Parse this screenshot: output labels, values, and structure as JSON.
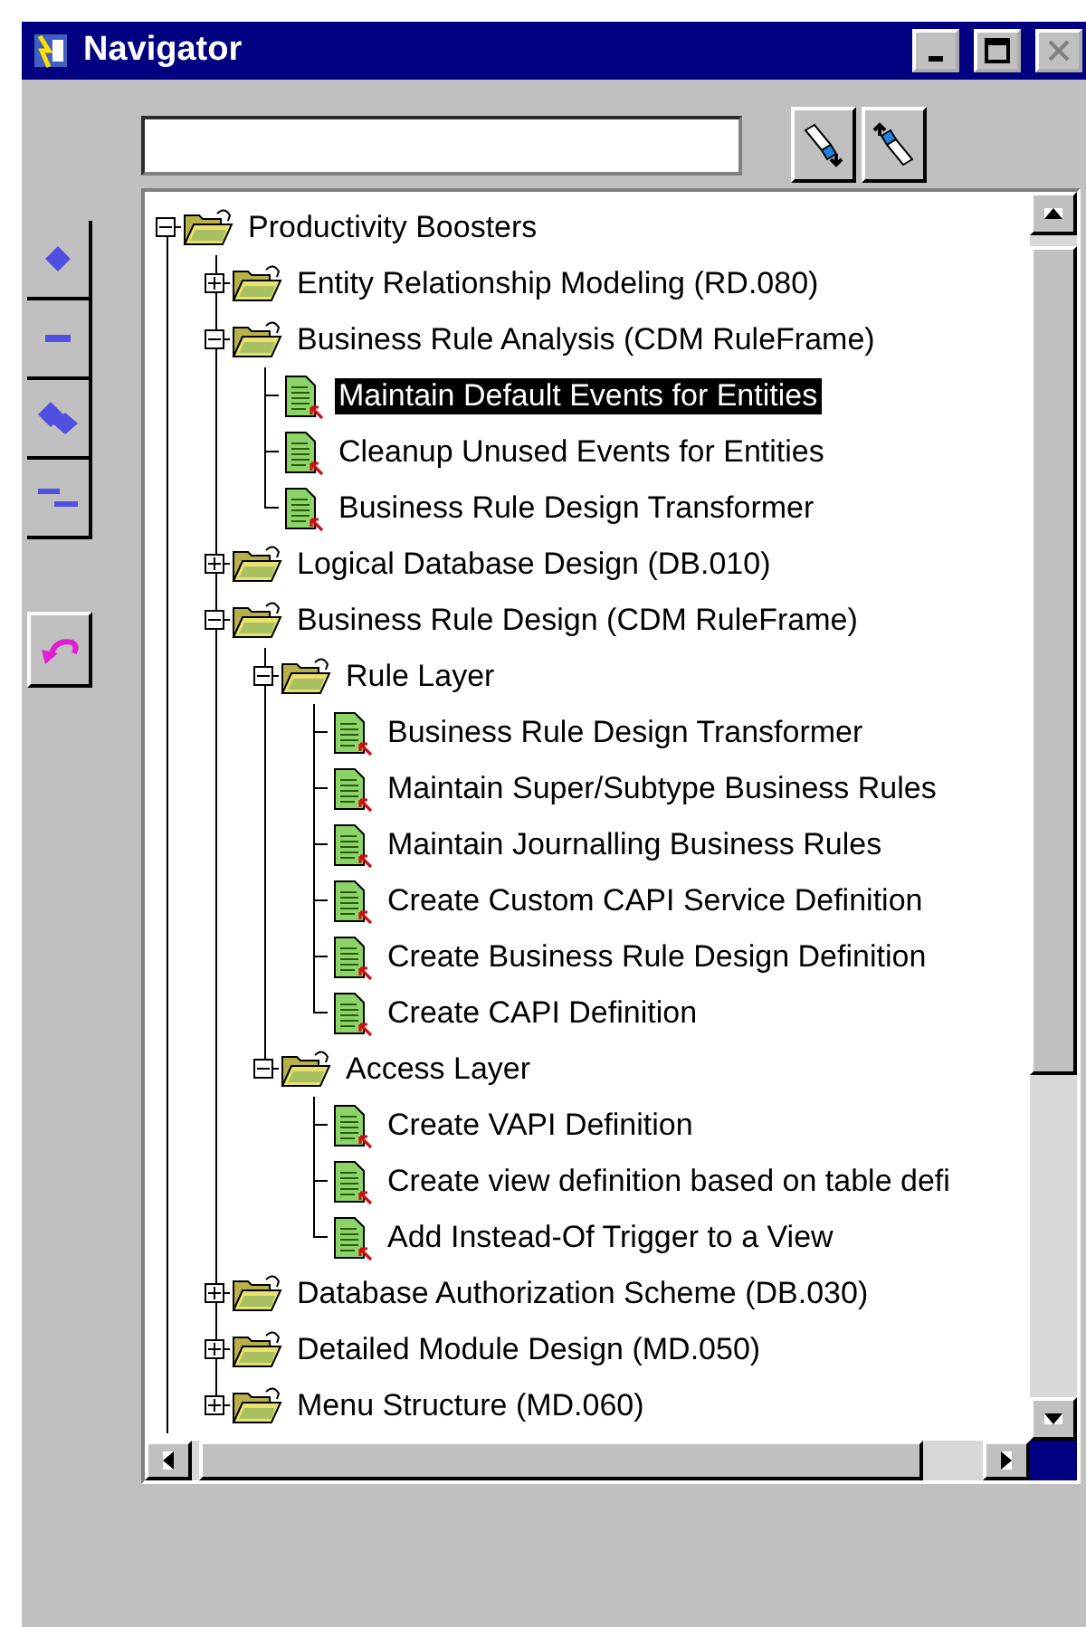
{
  "window": {
    "title": "Navigator"
  },
  "tree": [
    {
      "label": "Productivity Boosters",
      "kind": "folder",
      "expanded": true,
      "selected": false,
      "children": [
        {
          "label": "Entity Relationship Modeling (RD.080)",
          "kind": "folder",
          "expanded": false,
          "selected": false
        },
        {
          "label": "Business Rule Analysis (CDM RuleFrame)",
          "kind": "folder",
          "expanded": true,
          "selected": false,
          "children": [
            {
              "label": "Maintain Default Events for Entities",
              "kind": "document",
              "selected": true
            },
            {
              "label": "Cleanup Unused Events for Entities",
              "kind": "document",
              "selected": false
            },
            {
              "label": "Business Rule Design Transformer",
              "kind": "document",
              "selected": false
            }
          ]
        },
        {
          "label": "Logical Database Design (DB.010)",
          "kind": "folder",
          "expanded": false,
          "selected": false
        },
        {
          "label": "Business Rule Design (CDM RuleFrame)",
          "kind": "folder",
          "expanded": true,
          "selected": false,
          "children": [
            {
              "label": "Rule Layer",
              "kind": "folder",
              "expanded": true,
              "selected": false,
              "children": [
                {
                  "label": "Business Rule Design Transformer",
                  "kind": "document",
                  "selected": false
                },
                {
                  "label": "Maintain Super/Subtype Business Rules",
                  "kind": "document",
                  "selected": false
                },
                {
                  "label": "Maintain Journalling Business Rules",
                  "kind": "document",
                  "selected": false
                },
                {
                  "label": "Create Custom CAPI Service Definition",
                  "kind": "document",
                  "selected": false
                },
                {
                  "label": "Create Business Rule Design Definition",
                  "kind": "document",
                  "selected": false
                },
                {
                  "label": "Create CAPI Definition",
                  "kind": "document",
                  "selected": false
                }
              ]
            },
            {
              "label": "Access Layer",
              "kind": "folder",
              "expanded": true,
              "selected": false,
              "children": [
                {
                  "label": "Create VAPI Definition",
                  "kind": "document",
                  "selected": false
                },
                {
                  "label": "Create view definition based on table defi",
                  "kind": "document",
                  "selected": false
                },
                {
                  "label": "Add Instead-Of Trigger to a View",
                  "kind": "document",
                  "selected": false
                }
              ]
            }
          ]
        },
        {
          "label": "Database Authorization Scheme (DB.030)",
          "kind": "folder",
          "expanded": false,
          "selected": false
        },
        {
          "label": "Detailed Module Design (MD.050)",
          "kind": "folder",
          "expanded": false,
          "selected": false
        },
        {
          "label": "Menu Structure (MD.060)",
          "kind": "folder",
          "expanded": false,
          "selected": false
        }
      ]
    }
  ]
}
